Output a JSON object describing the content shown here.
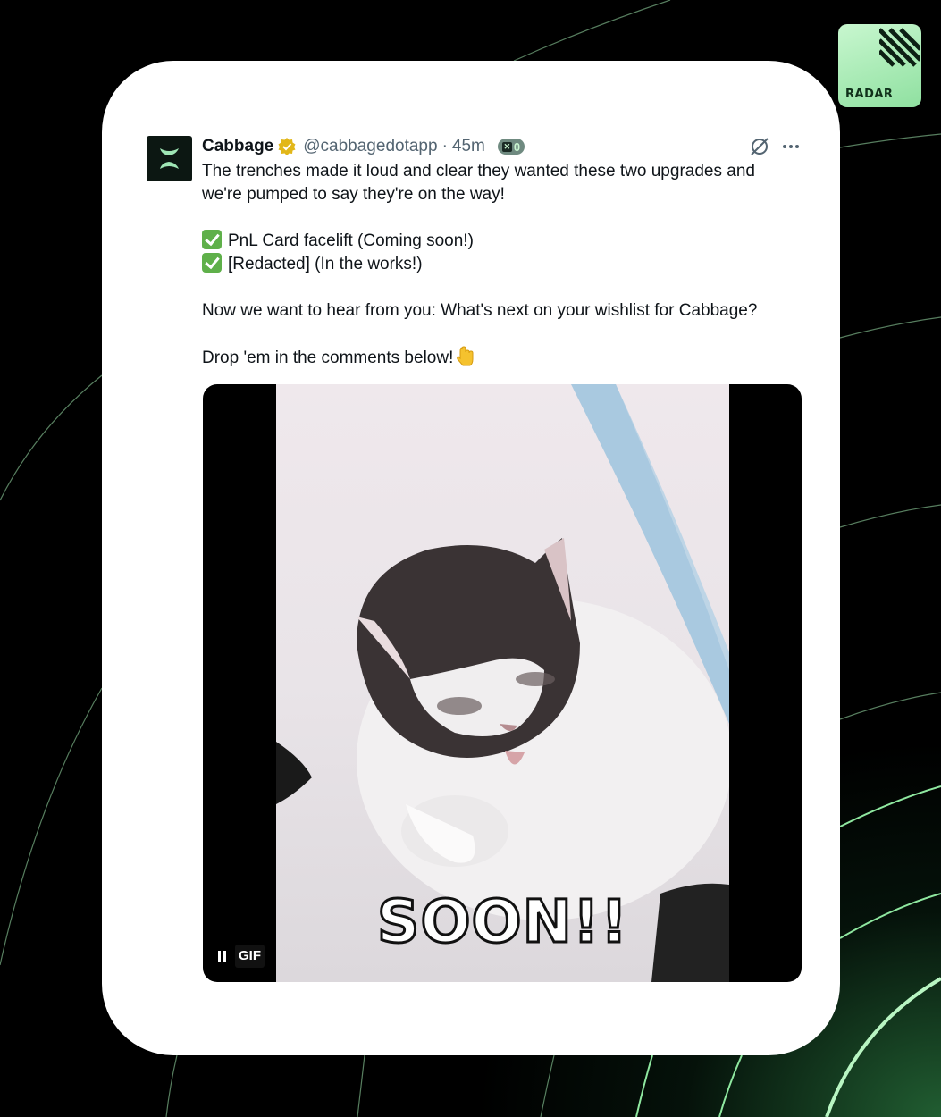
{
  "brand": {
    "label": "RADAR",
    "accent": "#8fe0a0"
  },
  "tweet": {
    "author_name": "Cabbage",
    "handle": "@cabbagedotapp",
    "separator": "·",
    "time": "45m",
    "badge_count": "0",
    "body_line1": "The trenches made it loud and clear they wanted these two upgrades and",
    "body_line2": "we're pumped to say they're on the way!",
    "item1": "PnL Card facelift  (Coming soon!)",
    "item2": "[Redacted]  (In the works!)",
    "question": "Now we want to hear from you: What's next on your wishlist for Cabbage?",
    "cta": "Drop 'em in the comments below!",
    "more_icon": "more-icon",
    "media": {
      "caption": "SOON!!",
      "gif_label": "GIF"
    }
  }
}
